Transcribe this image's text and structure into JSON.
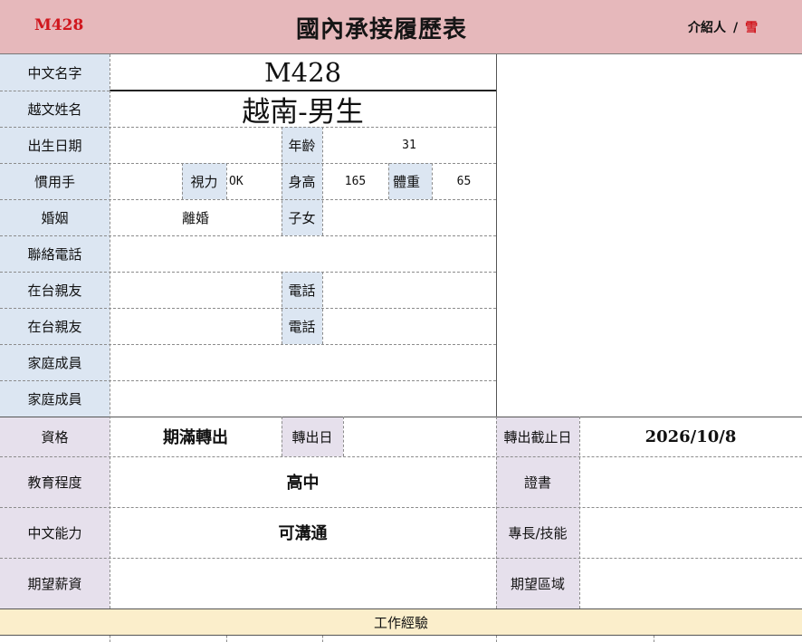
{
  "header": {
    "code": "M428",
    "title": "國內承接履歷表",
    "introducer_label": "介紹人",
    "introducer_sep": "/",
    "introducer_name": "雪"
  },
  "profile": {
    "chinese_name_label": "中文名字",
    "chinese_name_value": "M428",
    "vn_name_label": "越文姓名",
    "vn_name_value": "越南-男生",
    "birth_label": "出生日期",
    "birth_value": "",
    "age_label": "年齡",
    "age_value": "31",
    "hand_label": "慣用手",
    "hand_value": "",
    "vision_label": "視力",
    "vision_value": "OK",
    "height_label": "身高",
    "height_value": "165",
    "weight_label": "體重",
    "weight_value": "65",
    "marriage_label": "婚姻",
    "marriage_value": "離婚",
    "children_label": "子女",
    "children_value": "",
    "phone_label": "聯絡電話",
    "phone_value": "",
    "relative1_label": "在台親友",
    "relative1_phone_label": "電話",
    "relative2_label": "在台親友",
    "relative2_phone_label": "電話",
    "family1_label": "家庭成員",
    "family2_label": "家庭成員"
  },
  "details": {
    "qualification_label": "資格",
    "qualification_value": "期滿轉出",
    "transfer_date_label": "轉出日",
    "transfer_date_value": "",
    "deadline_label": "轉出截止日",
    "deadline_value": "2026/10/8",
    "education_label": "教育程度",
    "education_value": "高中",
    "certificate_label": "證書",
    "chinese_ability_label": "中文能力",
    "chinese_ability_value": "可溝通",
    "skills_label": "專長/技能",
    "salary_label": "期望薪資",
    "region_label": "期望區域"
  },
  "footer": {
    "work_experience_label": "工作經驗"
  }
}
